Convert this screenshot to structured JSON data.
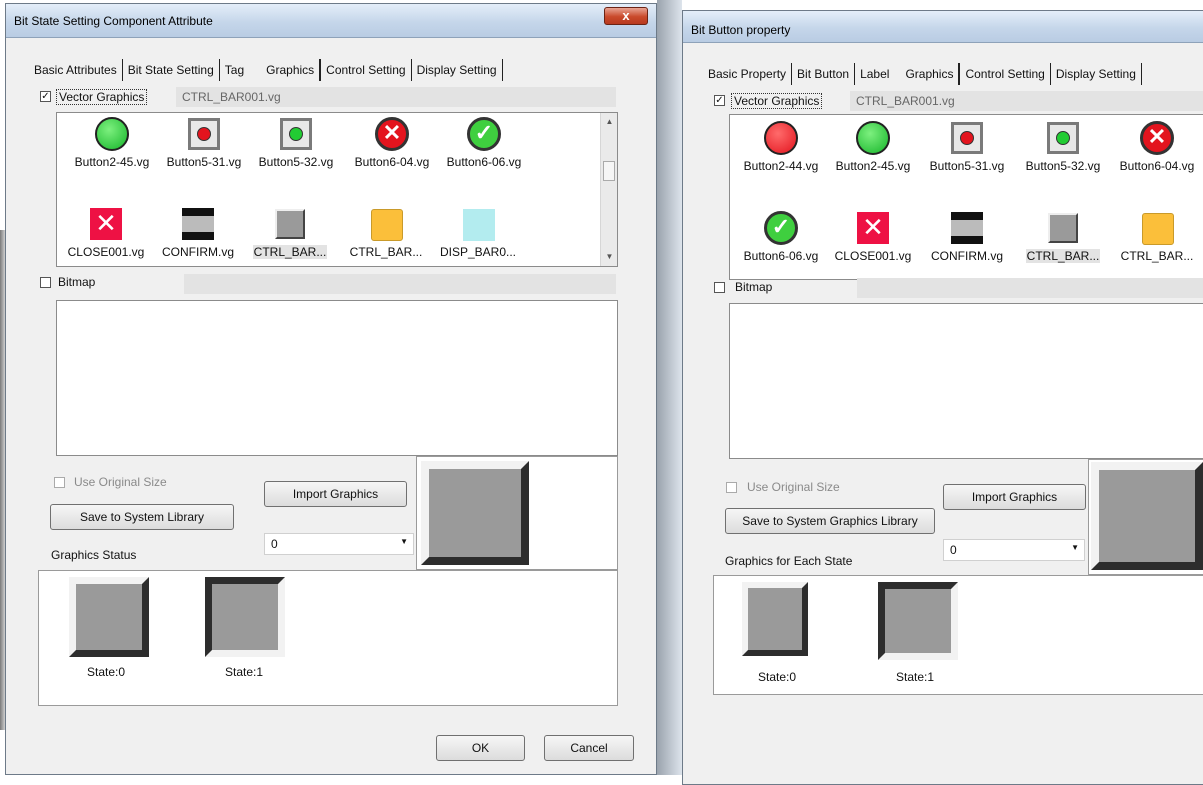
{
  "left": {
    "title": "Bit State Setting Component Attribute",
    "close": "x",
    "tabs": [
      "Basic Attributes",
      "Bit State Setting",
      "Tag",
      "Graphics",
      "Control Setting",
      "Display Setting"
    ],
    "active_tab": "Graphics",
    "vector_label": "Vector Graphics",
    "vector_file": "CTRL_BAR001.vg",
    "row1": [
      "Button2-45.vg",
      "Button5-31.vg",
      "Button5-32.vg",
      "Button6-04.vg",
      "Button6-06.vg"
    ],
    "row2": [
      "CLOSE001.vg",
      "CONFIRM.vg",
      "CTRL_BAR...",
      "CTRL_BAR...",
      "DISP_BAR0..."
    ],
    "bitmap_label": "Bitmap",
    "use_original_size": "Use Original Size",
    "import_button": "Import Graphics",
    "save_button": "Save to System Library",
    "state_select": "0",
    "status_label": "Graphics Status",
    "states": [
      "State:0",
      "State:1"
    ],
    "ok": "OK",
    "cancel": "Cancel"
  },
  "right": {
    "title": "Bit Button property",
    "tabs": [
      "Basic Property",
      "Bit Button",
      "Label",
      "Graphics",
      "Control Setting",
      "Display Setting"
    ],
    "active_tab": "Graphics",
    "vector_label": "Vector Graphics",
    "vector_file": "CTRL_BAR001.vg",
    "row1": [
      "Button2-44.vg",
      "Button2-45.vg",
      "Button5-31.vg",
      "Button5-32.vg",
      "Button6-04.vg"
    ],
    "row2": [
      "Button6-06.vg",
      "CLOSE001.vg",
      "CONFIRM.vg",
      "CTRL_BAR...",
      "CTRL_BAR..."
    ],
    "bitmap_label": "Bitmap",
    "use_original_size": "Use Original Size",
    "import_button": "Import Graphics",
    "save_button": "Save to System Graphics Library",
    "state_select": "0",
    "status_label": "Graphics for Each State",
    "states": [
      "State:0",
      "State:1"
    ]
  },
  "icons": {
    "green_button": "green-circle-icon",
    "red_button": "red-circle-icon",
    "framed_red": "framed-red-button-icon",
    "framed_green": "framed-green-button-icon",
    "red_x": "red-x-circle-icon",
    "green_check": "green-check-circle-icon",
    "close_square": "red-close-square-icon",
    "confirm": "confirm-bars-icon",
    "ctrl_bar_grey": "grey-square-icon",
    "ctrl_bar_orange": "orange-square-icon",
    "disp_bar": "cyan-square-icon"
  },
  "colors": {
    "green": "#22cc33",
    "red": "#e3141e",
    "orange": "#fbbf3a",
    "cyan": "#b3ecef",
    "grey_face": "#9a9a9a"
  }
}
